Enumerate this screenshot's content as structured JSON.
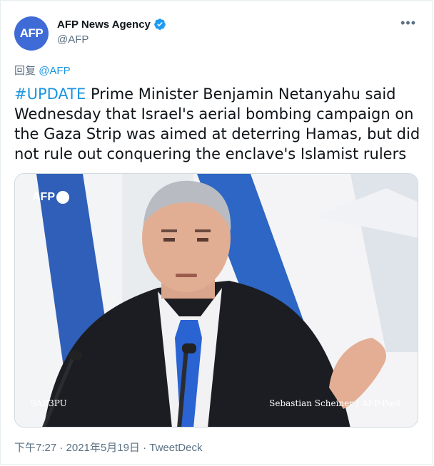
{
  "author": {
    "display_name": "AFP News Agency",
    "handle": "@AFP",
    "avatar_text": "AFP",
    "verified": true
  },
  "reply": {
    "prefix": "回复",
    "mention": "@AFP"
  },
  "tweet": {
    "hashtag": "#UPDATE",
    "text": " Prime Minister Benjamin Netanyahu said Wednesday that Israel's aerial bombing campaign on the Gaza Strip was aimed at deterring Hamas, but did not rule out conquering the enclave's Islamist rulers"
  },
  "media": {
    "watermark": "AFP",
    "photo_id": "9AB3PU",
    "credit": "Sebastian Scheiner / AFP-Pool"
  },
  "meta": {
    "time": "下午7:27 · 2021年5月19日 · ",
    "source": "TweetDeck"
  },
  "colors": {
    "link": "#1b95e0",
    "avatar_bg": "#3f6bd7",
    "secondary_text": "#5b7083"
  }
}
